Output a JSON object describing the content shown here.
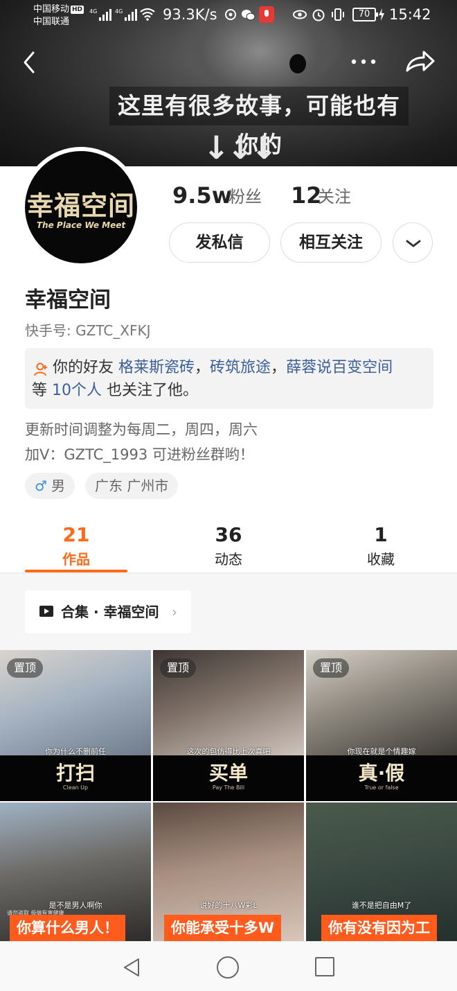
{
  "status_bar": {
    "carrier1": "中国移动",
    "hd_badge": "HD",
    "carrier2": "中国联通",
    "signal1_label": "4G",
    "signal2_label": "4G",
    "net_speed": "93.3K/s",
    "battery": "70",
    "time": "15:42"
  },
  "banner": {
    "caption": "这里有很多故事，可能也有你的",
    "arrows": "↓↓↓"
  },
  "profile": {
    "avatar_title": "幸福空间",
    "avatar_subtitle": "The Place We Meet",
    "followers_count": "9.5w",
    "followers_label": "粉丝",
    "following_count": "12",
    "following_label": "关注",
    "message_button": "发私信",
    "mutual_button": "相互关注",
    "name": "幸福空间",
    "kuaishou_id": "快手号: GZTC_XFKJ",
    "friends": {
      "prefix": "你的好友 ",
      "friend1": "格莱斯瓷砖",
      "sep1": "，",
      "friend2": "砖筑旅途",
      "sep2": "，",
      "friend3": "薛蓉说百变空间",
      "line2_prefix": "等 ",
      "count_link": "10个人",
      "line2_suffix": " 也关注了他。"
    },
    "bio_line1": "更新时间调整为每周二，周四，周六",
    "bio_line2": "加V：GZTC_1993   可进粉丝群哟！",
    "gender_symbol": "♂",
    "gender": "男",
    "location": "广东 广州市"
  },
  "tabs": [
    {
      "count": "21",
      "label": "作品"
    },
    {
      "count": "36",
      "label": "动态"
    },
    {
      "count": "1",
      "label": "收藏"
    }
  ],
  "collection": {
    "label": "合集 · 幸福空间",
    "chevron": "›"
  },
  "grid": {
    "pinned_label": "置顶",
    "row1": [
      {
        "subtitle": "你为什么不删前任",
        "logo": "打扫",
        "logo_sub": "Clean Up"
      },
      {
        "subtitle": "这次的包仿得比上次真吧",
        "logo": "买单",
        "logo_sub": "Pay The Bill"
      },
      {
        "subtitle": "你现在就是个情趣嫁",
        "logo": "真·假",
        "logo_sub": "True or false"
      }
    ],
    "row2": [
      {
        "subtitle": "是不是男人啊你",
        "tiny_tag": "请勿盗取   极做有害健康",
        "banner": "你算什么男人！"
      },
      {
        "subtitle": "说好的十八W彩L",
        "banner": "你能承受十多W"
      },
      {
        "subtitle": "谁不是把自由M了",
        "banner": "你有没有因为工"
      }
    ]
  },
  "colors": {
    "accent": "#ff6a1a",
    "link": "#3a5f9a",
    "orange_banner": "#ff5b1d"
  }
}
